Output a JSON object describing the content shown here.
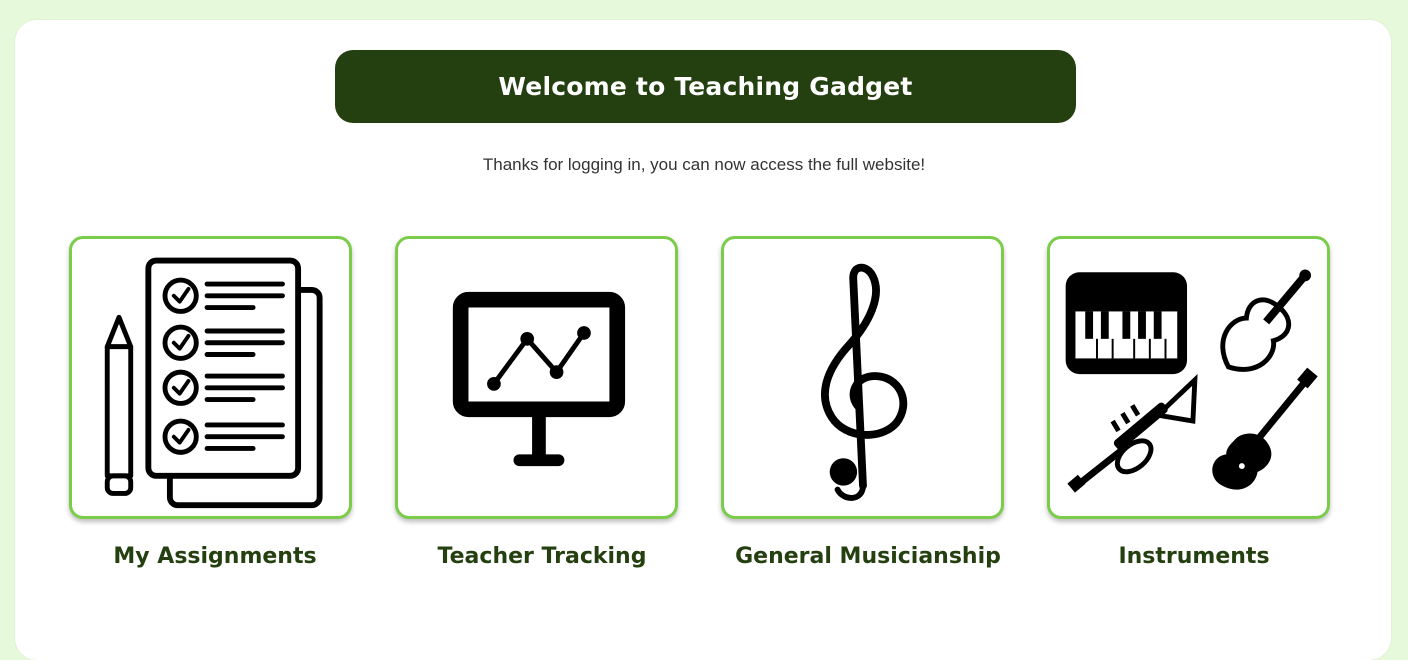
{
  "header": {
    "title": "Welcome to Teaching Gadget",
    "subtitle": "Thanks for logging in, you can now access the full website!"
  },
  "tiles": [
    {
      "label": "My Assignments",
      "icon": "assignments-checklist-icon"
    },
    {
      "label": "Teacher Tracking",
      "icon": "presentation-chart-icon"
    },
    {
      "label": "General Musicianship",
      "icon": "treble-clef-icon"
    },
    {
      "label": "Instruments",
      "icon": "instruments-icon"
    }
  ],
  "colors": {
    "background": "#e6fadb",
    "banner": "#254010",
    "tile_border": "#7ccc4c",
    "label": "#254010"
  }
}
